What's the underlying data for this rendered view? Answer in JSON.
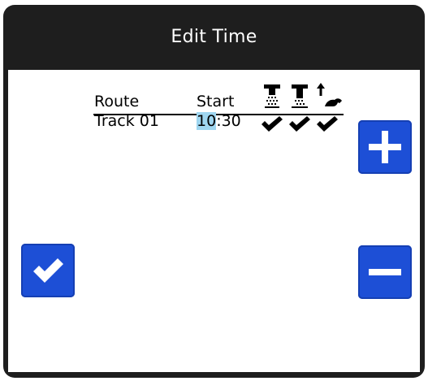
{
  "header": {
    "title": "Edit Time"
  },
  "table": {
    "columns": {
      "route": "Route",
      "start": "Start"
    },
    "icon_columns": [
      "spray-nozzle-icon",
      "spray-ground-icon",
      "raise-boom-icon"
    ],
    "rows": [
      {
        "route": "Track 01",
        "start_hour": "10",
        "start_rest": ":30",
        "checks": [
          true,
          true,
          true
        ]
      }
    ]
  },
  "buttons": {
    "confirm": "check-icon",
    "increment": "plus-icon",
    "decrement": "minus-icon"
  },
  "colors": {
    "accent": "#1d4fd6",
    "highlight": "#9fd6f0",
    "frame": "#1e1e1e"
  }
}
